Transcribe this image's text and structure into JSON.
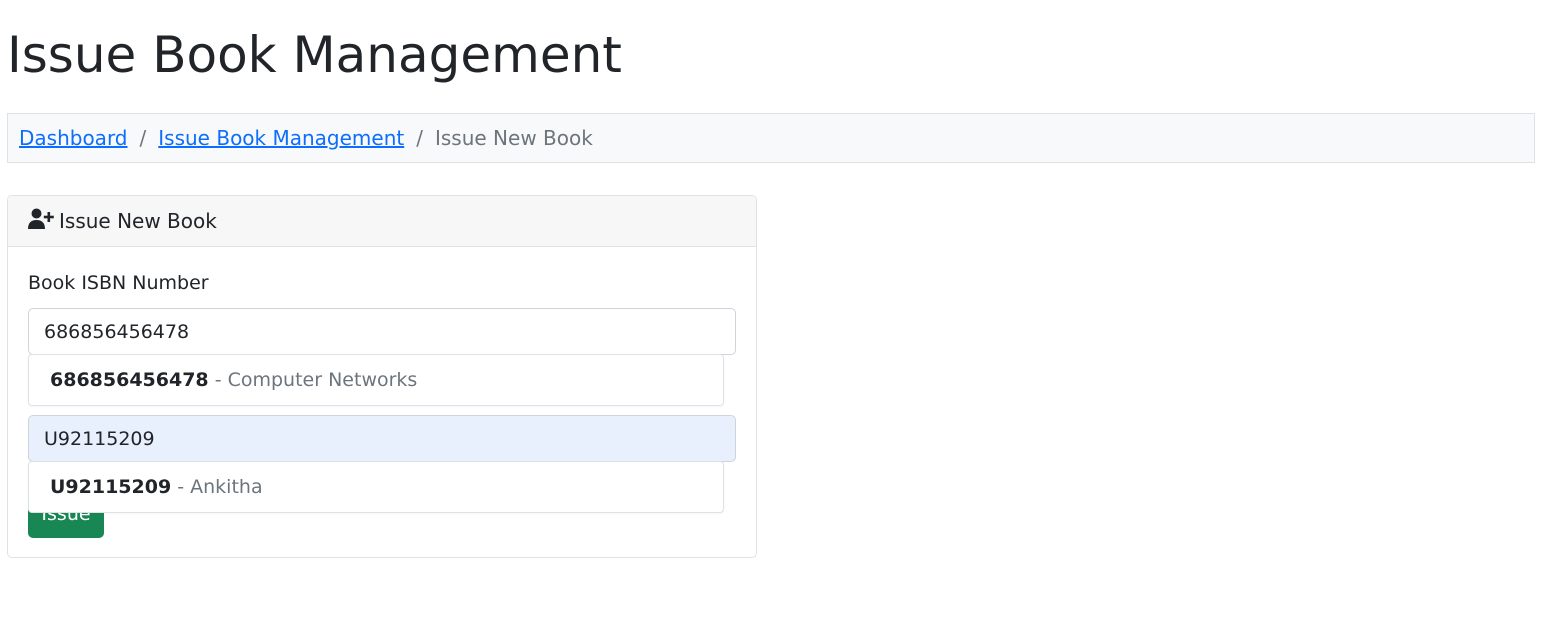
{
  "page": {
    "title": "Issue Book Management"
  },
  "breadcrumb": {
    "items": [
      {
        "label": "Dashboard",
        "link": true
      },
      {
        "label": "Issue Book Management",
        "link": true
      },
      {
        "label": "Issue New Book",
        "link": false
      }
    ],
    "separator": "/"
  },
  "card": {
    "header_icon": "user-plus-icon",
    "header_title": "Issue New Book",
    "isbn": {
      "label": "Book ISBN Number",
      "value": "686856456478",
      "suggestion": {
        "code": "686856456478",
        "separator": " - ",
        "name": "Computer Networks"
      }
    },
    "user": {
      "value": "U92115209",
      "suggestion": {
        "code": "U92115209",
        "separator": " - ",
        "name": "Ankitha"
      }
    },
    "submit_label": "Issue"
  },
  "colors": {
    "link": "#0d6efd",
    "success": "#198754",
    "autofill_bg": "#e8f0fe",
    "muted": "#6c757d"
  }
}
